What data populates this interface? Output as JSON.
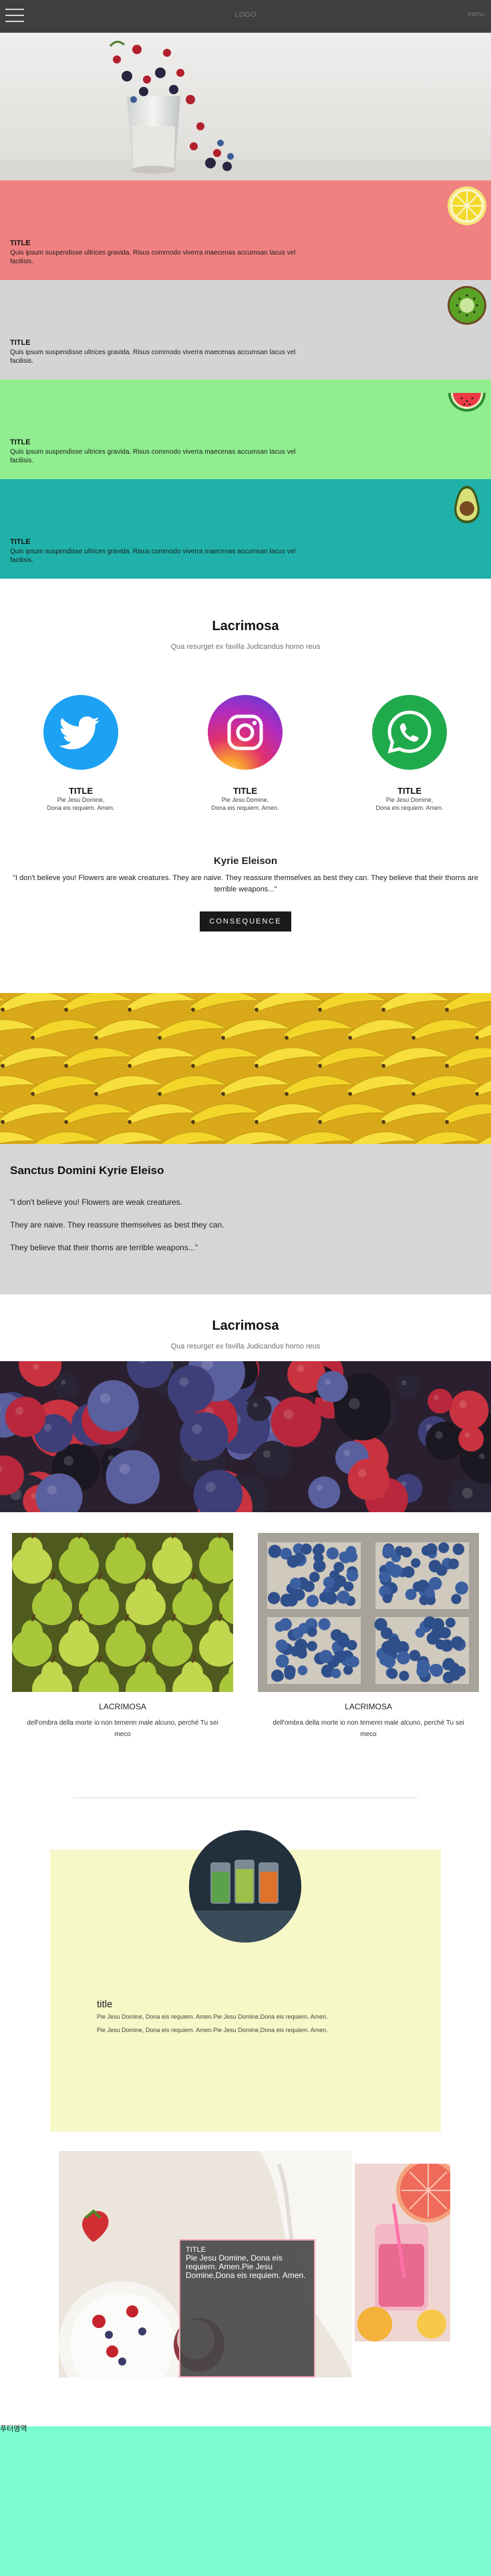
{
  "header": {
    "brand": "LOGO",
    "link": "menu"
  },
  "bands": [
    {
      "title": "TITLE",
      "text": "Quis ipsum suspendisse ultrices gravida. Risus commodo viverra maecenas accumsan lacus vel facilisis.",
      "color": "#f08181",
      "fruit": "lemon"
    },
    {
      "title": "TITLE",
      "text": "Quis ipsum suspendisse ultrices gravida. Risus commodo viverra maecenas accumsan lacus vel facilisis.",
      "color": "#d4d4d4",
      "fruit": "kiwi"
    },
    {
      "title": "TITLE",
      "text": "Quis ipsum suspendisse ultrices gravida. Risus commodo viverra maecenas accumsan lacus vel facilisis.",
      "color": "#90ee90",
      "fruit": "watermelon"
    },
    {
      "title": "TITLE",
      "text": "Quis ipsum suspendisse ultrices gravida. Risus commodo viverra maecenas accumsan lacus vel facilisis.",
      "color": "#20b2aa",
      "fruit": "avocado"
    }
  ],
  "social_section": {
    "title": "Lacrimosa",
    "subtitle": "Qua resurget ex favilla Judicandus homo reus",
    "items": [
      {
        "icon": "twitter-icon",
        "title": "TITLE",
        "line1": "Pie Jesu Domine,",
        "line2": "Dona eis requiem. Amen."
      },
      {
        "icon": "instagram-icon",
        "title": "TITLE",
        "line1": "Pie Jesu Domine,",
        "line2": "Dona eis requiem. Amen."
      },
      {
        "icon": "whatsapp-icon",
        "title": "TITLE",
        "line1": "Pie Jesu Domine,",
        "line2": "Dona eis requiem. Amen."
      }
    ]
  },
  "kyrie": {
    "title": "Kyrie Eleison",
    "quote": "\"I don't believe you! Flowers are weak creatures. They are naive. They reassure themselves as best they can. They believe that their thorns are terrible weapons...\"",
    "button": "CONSEQUENCE"
  },
  "sanctus": {
    "title": "Sanctus Domini Kyrie Eleiso",
    "lines": [
      "\"I don't believe you! Flowers are weak creatures.",
      "They are naive. They reassure themselves as best they can.",
      "They believe that their thorns are terrible weapons...\""
    ]
  },
  "gallery": {
    "title": "Lacrimosa",
    "subtitle": "Qua resurget ex favilla Judicandus homo reus",
    "cards": [
      {
        "title": "LACRIMOSA",
        "line1": "dell'ombra della morte io non temerei male alcuno, perché Tu sei",
        "line2": "meco"
      },
      {
        "title": "LACRIMOSA",
        "line1": "dell'ombra della morte io non temerei male alcuno, perché Tu sei",
        "line2": "meco"
      }
    ]
  },
  "feature": {
    "title": "title",
    "line1": "Pie Jesu Domine, Dona eis requiem. Amen.Pie Jesu Domine,Dona eis requiem. Amen.",
    "line2": "Pie Jesu Domine, Dona eis requiem. Amen.Pie Jesu Domine,Dona eis requiem. Amen."
  },
  "overlay": {
    "title": "TITLE",
    "text": "Pie Jesu Domine, Dona eis requiem. Amen.Pie Jesu Domine,Dona eis requiem. Amen."
  },
  "footer": {
    "label": "푸터영역",
    "color": "#7bfbd1"
  }
}
